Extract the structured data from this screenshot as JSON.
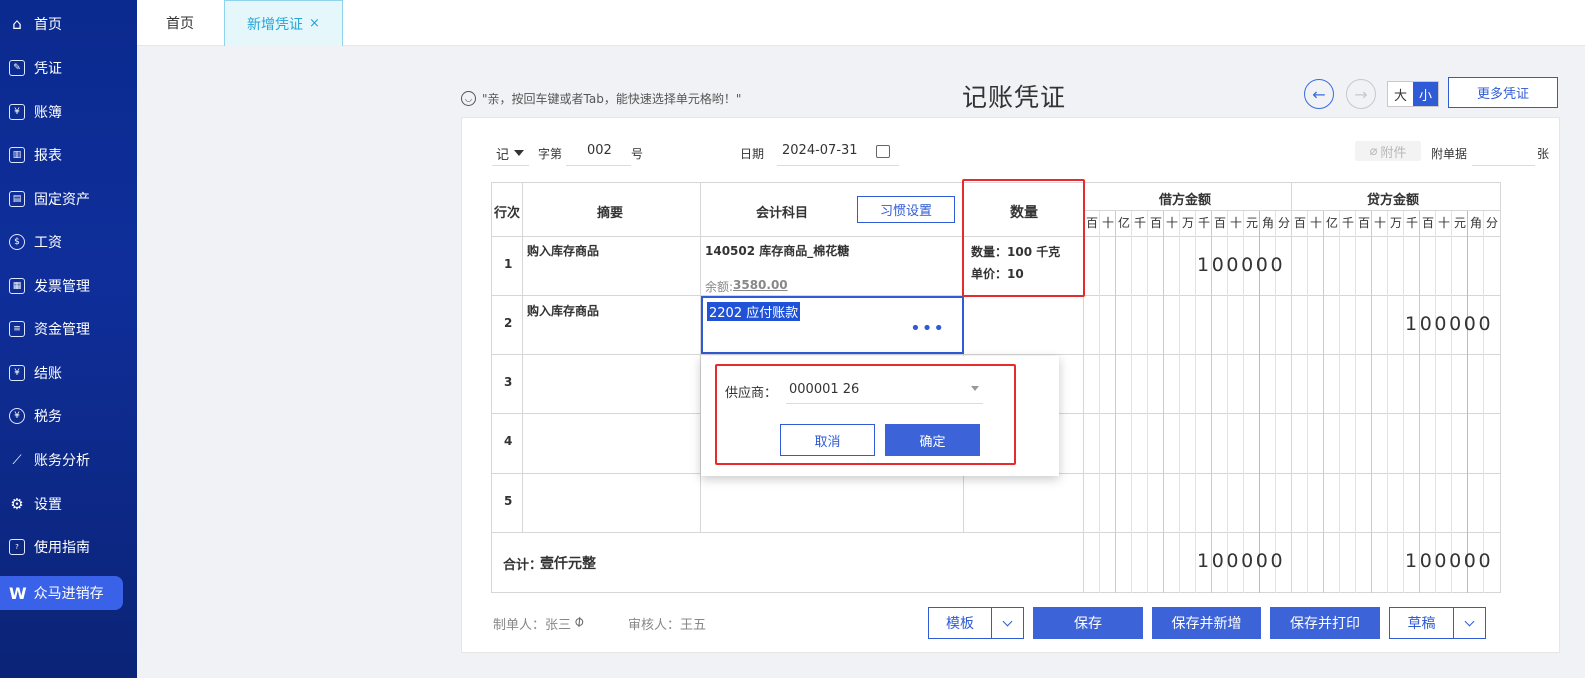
{
  "sidebar": {
    "items": [
      {
        "label": "首页",
        "icon": "home-icon"
      },
      {
        "label": "凭证",
        "icon": "voucher-icon"
      },
      {
        "label": "账簿",
        "icon": "ledger-icon"
      },
      {
        "label": "报表",
        "icon": "report-icon"
      },
      {
        "label": "固定资产",
        "icon": "asset-icon"
      },
      {
        "label": "工资",
        "icon": "salary-icon"
      },
      {
        "label": "发票管理",
        "icon": "invoice-icon"
      },
      {
        "label": "资金管理",
        "icon": "fund-icon"
      },
      {
        "label": "结账",
        "icon": "closing-icon"
      },
      {
        "label": "税务",
        "icon": "tax-icon"
      },
      {
        "label": "账务分析",
        "icon": "analysis-icon"
      },
      {
        "label": "设置",
        "icon": "gear-icon"
      },
      {
        "label": "使用指南",
        "icon": "guide-icon"
      }
    ],
    "active_app": {
      "logo": "W",
      "label": "众马进销存"
    }
  },
  "tabs": {
    "home": "首页",
    "new_voucher": "新增凭证",
    "close": "×"
  },
  "header": {
    "tip": "\"亲，按回车键或者Tab，能快速选择单元格哟！\"",
    "title": "记账凭证",
    "size_big": "大",
    "size_small": "小",
    "more": "更多凭证"
  },
  "controls": {
    "voucher_type": "记",
    "zi_di": "字第",
    "number": "002",
    "hao": "号",
    "date_label": "日期",
    "date_value": "2024-07-31",
    "attachment": "附件",
    "attach_docs": "附单据",
    "zhang": "张"
  },
  "table": {
    "headers": {
      "row_no": "行次",
      "summary": "摘要",
      "account": "会计科目",
      "habit": "习惯设置",
      "quantity": "数量",
      "debit": "借方金额",
      "credit": "贷方金额"
    },
    "digit_units": [
      "百",
      "十",
      "亿",
      "千",
      "百",
      "十",
      "万",
      "千",
      "百",
      "十",
      "元",
      "角",
      "分"
    ],
    "rows": [
      {
        "no": "1",
        "summary": "购入库存商品",
        "account": "140502 库存商品_棉花糖",
        "balance_label": "余额:",
        "balance": "3580.00",
        "qty": "数量：100 千克",
        "price": "单价：10",
        "debit": "100000",
        "credit": ""
      },
      {
        "no": "2",
        "summary": "购入库存商品",
        "account": "2202   应付账款",
        "debit": "",
        "credit": "100000"
      },
      {
        "no": "3",
        "summary": "",
        "account": ""
      },
      {
        "no": "4",
        "summary": "",
        "account": ""
      },
      {
        "no": "5",
        "summary": "",
        "account": ""
      }
    ],
    "total_label": "合计：",
    "total_words": "壹仟元整",
    "total_debit": "100000",
    "total_credit": "100000",
    "ellipsis": "•••"
  },
  "popup": {
    "supplier_label": "供应商：",
    "supplier_value": "000001 26",
    "cancel": "取消",
    "ok": "确定"
  },
  "footer": {
    "maker": "制单人：张三",
    "auditor": "审核人：王五",
    "template": "模板",
    "save": "保存",
    "save_new": "保存并新增",
    "save_print": "保存并打印",
    "draft": "草稿"
  },
  "colors": {
    "brand": "#0f2e9a",
    "accent": "#3c63d8",
    "highlight": "#e52b2b"
  }
}
